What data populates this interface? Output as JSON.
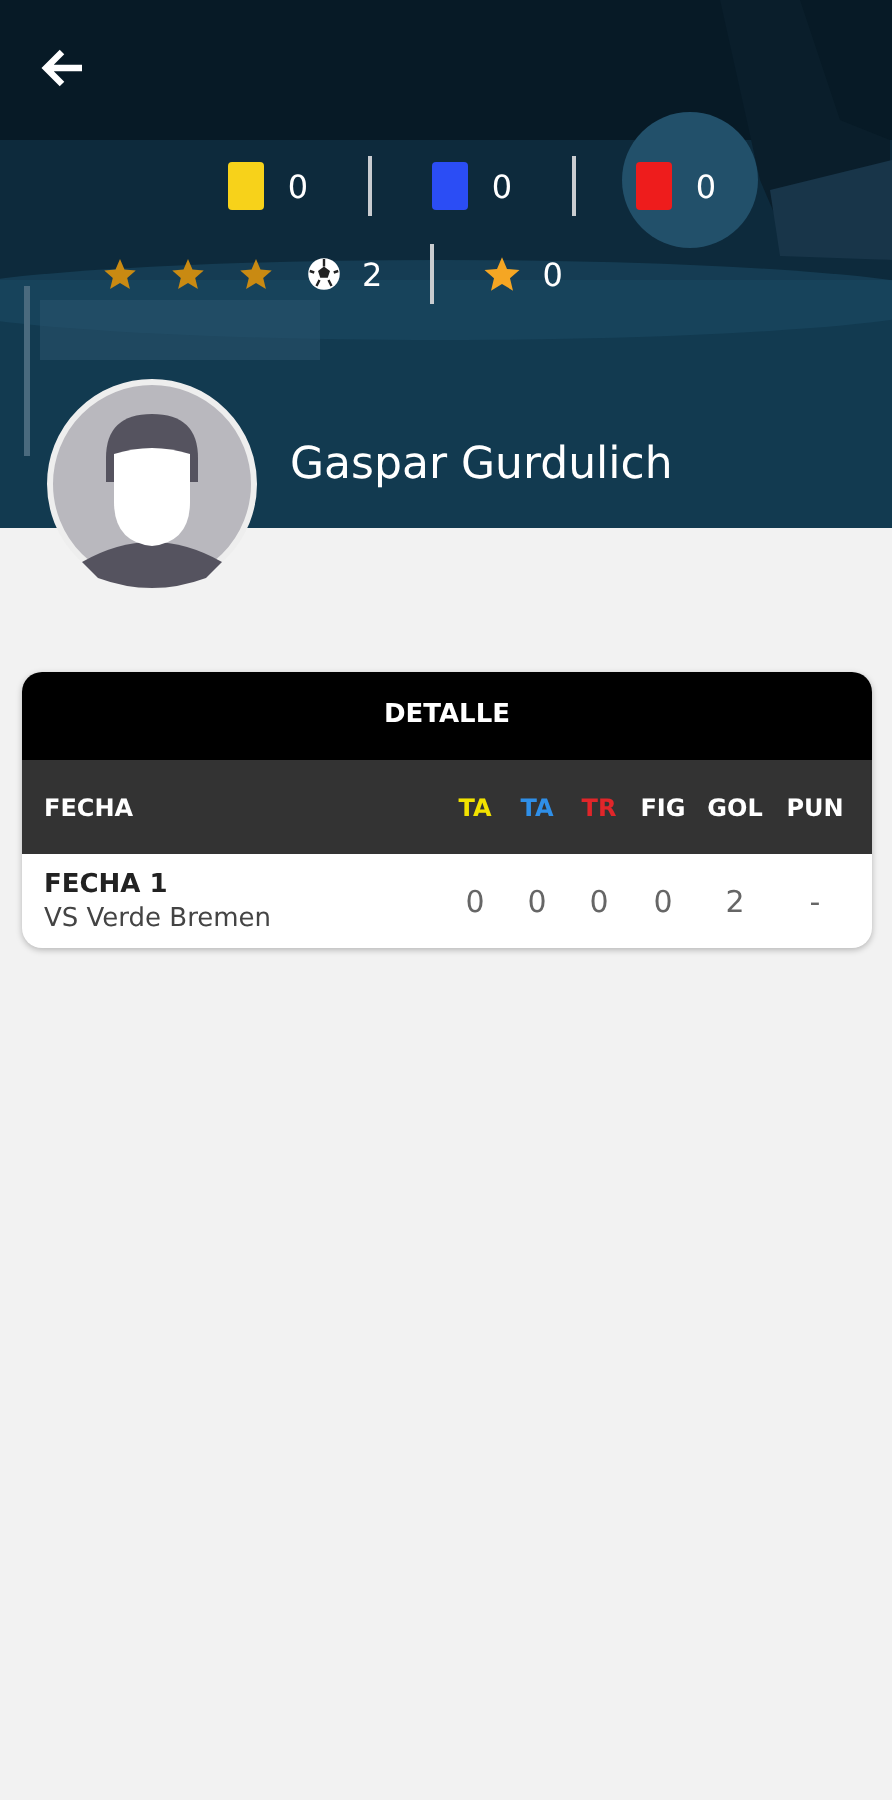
{
  "player": {
    "name": "Gaspar Gurdulich"
  },
  "cards": [
    {
      "kind": "yellow",
      "count": "0"
    },
    {
      "kind": "blue",
      "count": "0"
    },
    {
      "kind": "red",
      "count": "0"
    }
  ],
  "rating": {
    "stars": 3
  },
  "goals": {
    "count": "2"
  },
  "figure": {
    "count": "0"
  },
  "detail": {
    "title": "DETALLE",
    "columns": [
      {
        "label": "FECHA",
        "color": "#ffffff"
      },
      {
        "label": "TA",
        "color": "#f2e200"
      },
      {
        "label": "TA",
        "color": "#2f8fe8"
      },
      {
        "label": "TR",
        "color": "#e0262a"
      },
      {
        "label": "FIG",
        "color": "#ffffff"
      },
      {
        "label": "GOL",
        "color": "#ffffff"
      },
      {
        "label": "PUN",
        "color": "#ffffff"
      }
    ],
    "rows": [
      {
        "fecha": "FECHA 1",
        "rival": "VS Verde Bremen",
        "values": [
          "0",
          "0",
          "0",
          "0",
          "2",
          "-"
        ]
      }
    ]
  }
}
